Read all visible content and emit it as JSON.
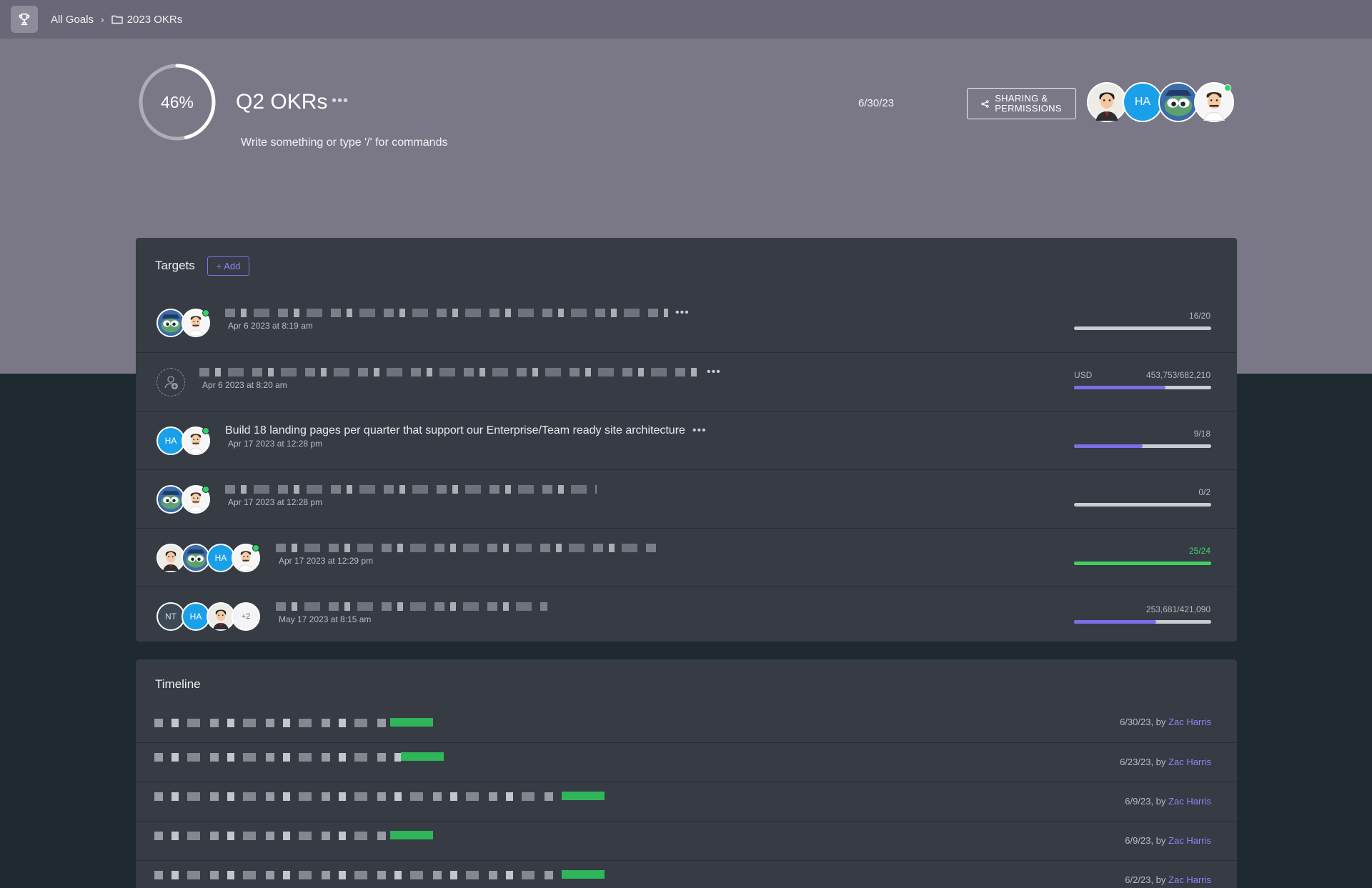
{
  "breadcrumb": {
    "root": "All Goals",
    "folder": "2023 OKRs"
  },
  "goal": {
    "progress_label": "46%",
    "progress_fraction": 0.46,
    "title": "Q2 OKRs",
    "more": "•••",
    "description_placeholder": "Write something or type '/' for commands",
    "due_date": "6/30/23",
    "share_label_line1": "SHARING &",
    "share_label_line2": "PERMISSIONS",
    "members": [
      {
        "type": "suit"
      },
      {
        "type": "initials",
        "initials": "HA"
      },
      {
        "type": "fish"
      },
      {
        "type": "chef",
        "online": true
      }
    ]
  },
  "targets": {
    "title": "Targets",
    "add_label": "+ Add",
    "items": [
      {
        "avatars": [
          "fish",
          "chef"
        ],
        "online": true,
        "name": "",
        "time": "Apr 6 2023 at 8:19 am",
        "unit": "",
        "value_label": "16/20",
        "progress": 0.0,
        "good": false
      },
      {
        "avatars": [
          "empty"
        ],
        "online": false,
        "name": "",
        "time": "Apr 6 2023 at 8:20 am",
        "unit": "USD",
        "value_label": "453,753/682,210",
        "progress": 0.665,
        "good": false
      },
      {
        "avatars": [
          "HA",
          "chef"
        ],
        "online": true,
        "name": "Build 18 landing pages per quarter that support our Enterprise/Team ready site architecture",
        "time": "Apr 17 2023 at 12:28 pm",
        "unit": "",
        "value_label": "9/18",
        "progress": 0.5,
        "good": false
      },
      {
        "avatars": [
          "fish",
          "chef"
        ],
        "online": true,
        "name": "",
        "time": "Apr 17 2023 at 12:28 pm",
        "unit": "",
        "value_label": "0/2",
        "progress": 0.0,
        "good": false
      },
      {
        "avatars": [
          "suit",
          "fish",
          "HA",
          "chef"
        ],
        "online": true,
        "name": "",
        "time": "Apr 17 2023 at 12:29 pm",
        "unit": "",
        "value_label": "25/24",
        "progress": 1.0,
        "good": true
      },
      {
        "avatars": [
          "NT",
          "HA",
          "suit",
          "+2"
        ],
        "online": false,
        "name": "",
        "time": "May 17 2023 at 8:15 am",
        "unit": "",
        "value_label": "253,681/421,090",
        "progress": 0.6,
        "good": false
      }
    ]
  },
  "timeline": {
    "title": "Timeline",
    "by_word": ", by",
    "entries": [
      {
        "date": "6/30/23",
        "author": "Zac Harris"
      },
      {
        "date": "6/23/23",
        "author": "Zac Harris"
      },
      {
        "date": "6/9/23",
        "author": "Zac Harris"
      },
      {
        "date": "6/9/23",
        "author": "Zac Harris"
      },
      {
        "date": "6/2/23",
        "author": "Zac Harris"
      }
    ]
  },
  "colors": {
    "accent": "#7c6ee6",
    "success": "#3fcf63",
    "header_bg": "#7a7787",
    "panel_bg": "#363b44"
  },
  "icons": {
    "trophy": "trophy-icon",
    "folder": "folder-icon",
    "chevron": "chevron-right-icon",
    "share": "share-icon",
    "more": "more-horizontal-icon"
  }
}
